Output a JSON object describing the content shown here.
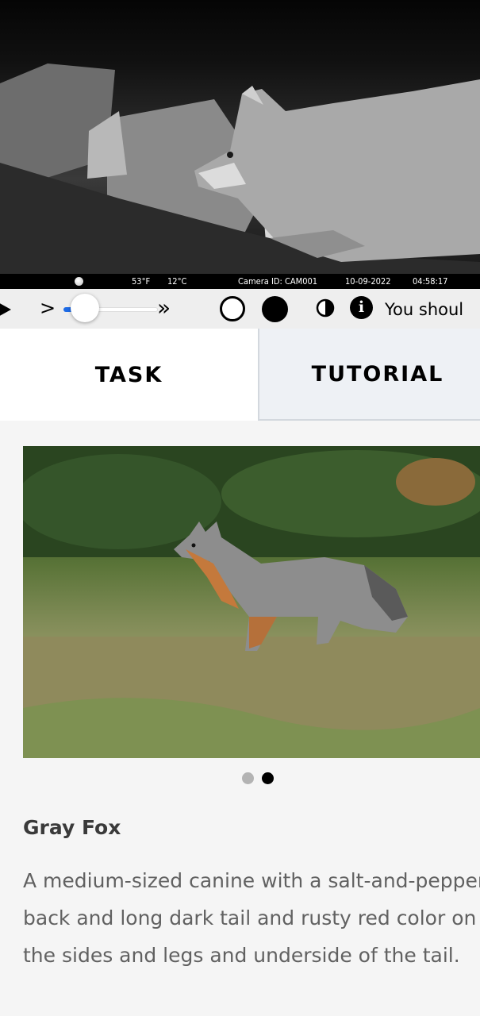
{
  "camera": {
    "temperature_f": "53°F",
    "temperature_c": "12°C",
    "camera_id": "Camera ID: CAM001",
    "date": "10-09-2022",
    "time": "04:58:17"
  },
  "controls": {
    "play_icon": "play-icon",
    "step_glyph": ">",
    "fast_glyph": "»",
    "progress": 0.2,
    "message": "You shoul"
  },
  "tabs": [
    {
      "label": "TASK",
      "active": true
    },
    {
      "label": "TUTORIAL",
      "active": false
    }
  ],
  "carousel": {
    "count": 2,
    "active_index": 1
  },
  "species": {
    "name": "Gray Fox",
    "description": "A medium-sized canine with a salt-and-pepper back and long dark tail and rusty red color on the sides and legs and underside of the tail."
  },
  "colors": {
    "accent": "#1e6be6"
  }
}
